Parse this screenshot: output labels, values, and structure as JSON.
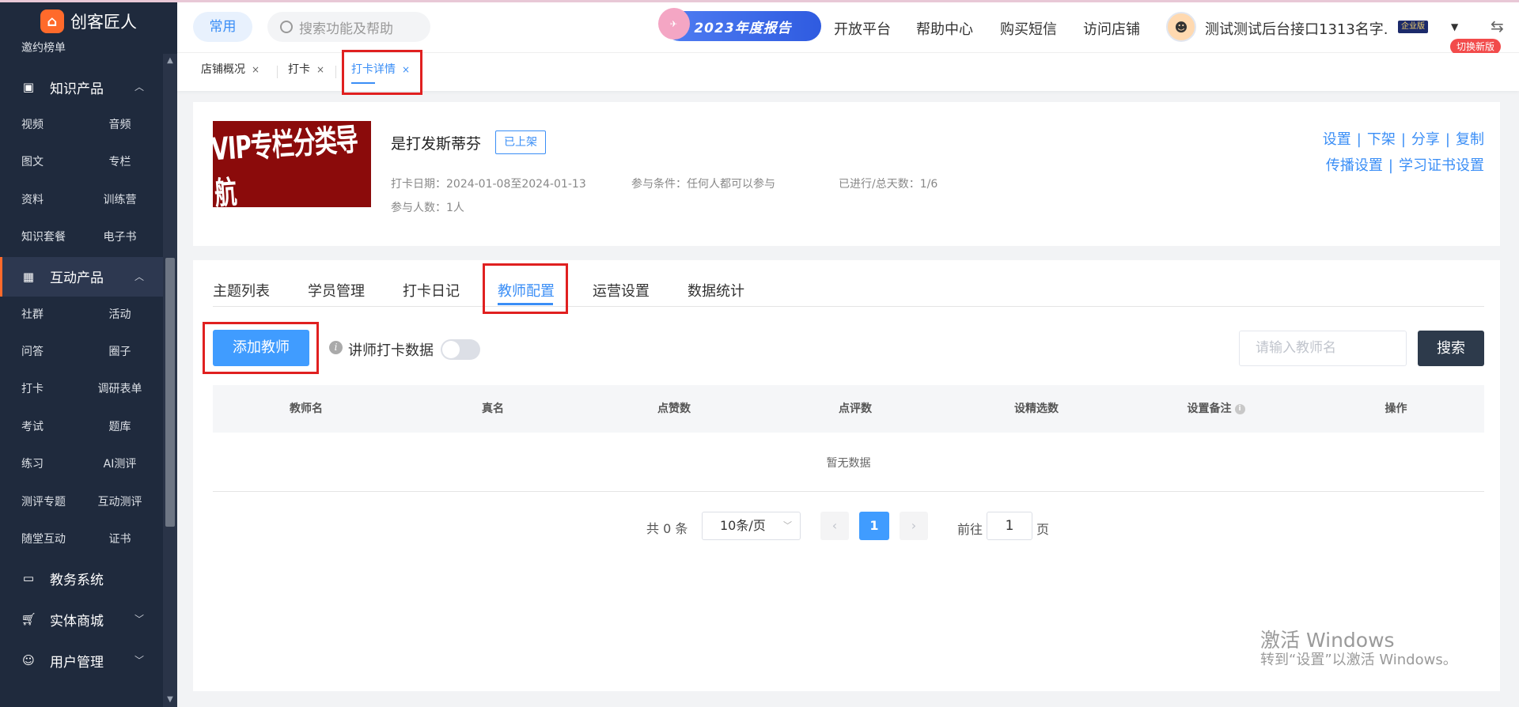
{
  "app": {
    "name": "创客匠人"
  },
  "sidebar": {
    "top_item": "邀约榜单",
    "groups": [
      {
        "label": "知识产品",
        "items": [
          "视频",
          "音频",
          "图文",
          "专栏",
          "资料",
          "训练营",
          "知识套餐",
          "电子书"
        ]
      },
      {
        "label": "互动产品",
        "items": [
          "社群",
          "活动",
          "问答",
          "圈子",
          "打卡",
          "调研表单",
          "考试",
          "题库",
          "练习",
          "AI测评",
          "测评专题",
          "互动测评",
          "随堂互动",
          "证书"
        ]
      }
    ],
    "bottom_groups": [
      "教务系统",
      "实体商城",
      "用户管理"
    ]
  },
  "topbar": {
    "common_label": "常用",
    "search_placeholder": "搜索功能及帮助",
    "report_banner": "2023年度报告",
    "links": [
      "开放平台",
      "帮助中心",
      "购买短信",
      "访问店铺"
    ],
    "user_name": "测试测试后台接口1313名字...",
    "enterprise_badge": "企业版",
    "new_version": "切换新版"
  },
  "tabs": [
    {
      "label": "店铺概况",
      "close": "×"
    },
    {
      "label": "打卡",
      "close": "×"
    },
    {
      "label": "打卡详情",
      "close": "×"
    }
  ],
  "course": {
    "cover_text": "VIP专栏分类导航",
    "title": "是打发斯蒂芬",
    "status": "已上架",
    "date": "打卡日期：2024-01-08至2024-01-13",
    "condition": "参与条件：任何人都可以参与",
    "progress": "已进行/总天数：1/6",
    "participants": "参与人数：1人",
    "actions_row1": [
      "设置",
      "下架",
      "分享",
      "复制"
    ],
    "actions_row2": [
      "传播设置",
      "学习证书设置"
    ],
    "separator": "|"
  },
  "inner_tabs": [
    "主题列表",
    "学员管理",
    "打卡日记",
    "教师配置",
    "运营设置",
    "数据统计"
  ],
  "toolbar": {
    "add_teacher": "添加教师",
    "toggle_label": "讲师打卡数据",
    "teacher_placeholder": "请输入教师名",
    "search": "搜索"
  },
  "table": {
    "columns": [
      "教师名",
      "真名",
      "点赞数",
      "点评数",
      "设精选数",
      "设置备注",
      "操作"
    ],
    "empty_text": "暂无数据"
  },
  "pagination": {
    "total": "共 0 条",
    "page_size": "10条/页",
    "current_page": "1",
    "goto_prefix": "前往",
    "goto_value": "1",
    "goto_suffix": "页"
  },
  "watermark": {
    "line1": "激活 Windows",
    "line2": "转到“设置”以激活 Windows。"
  },
  "colors": {
    "sidebar_bg": "#1f2a3d",
    "accent": "#3a8ef6",
    "primary_button": "#409cff",
    "dark_button": "#2d3a4b",
    "highlight_box": "#e02020",
    "brand_orange": "#ff6a2b"
  }
}
